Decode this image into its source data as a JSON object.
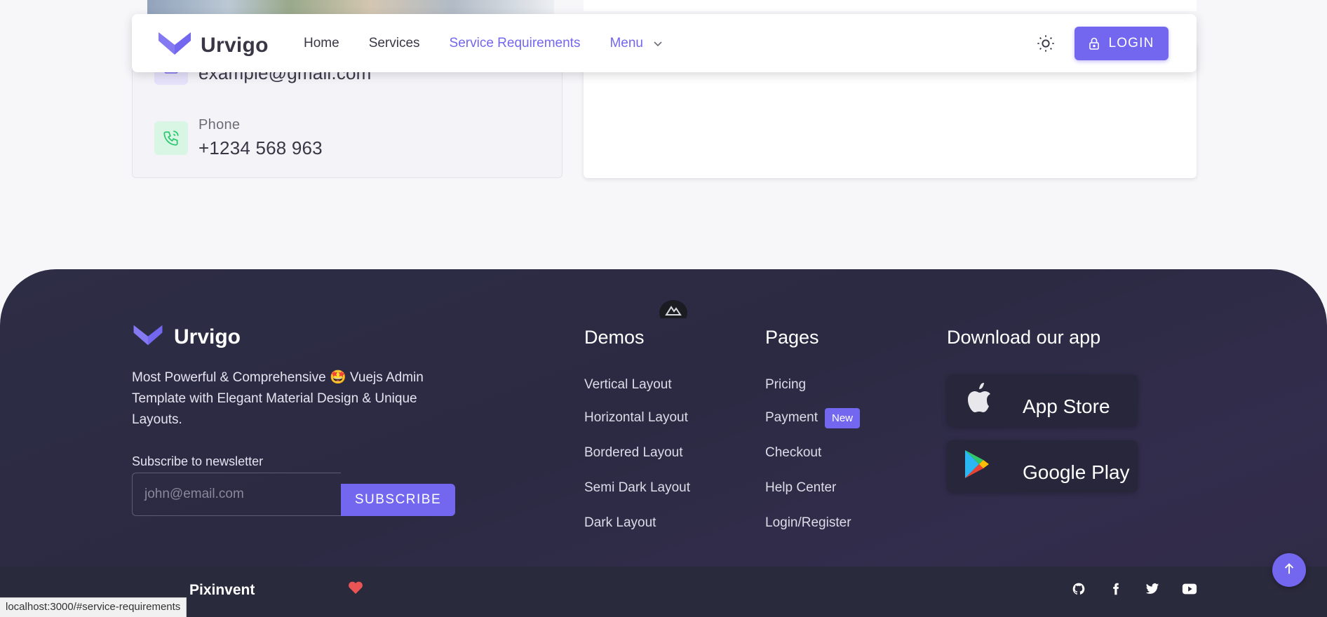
{
  "nav": {
    "brand": "Urvigo",
    "links": [
      "Home",
      "Services",
      "Service Requirements"
    ],
    "menu_label": "Menu",
    "login_label": "LOGIN"
  },
  "contact": {
    "email_value": "example@gmail.com",
    "phone_label": "Phone",
    "phone_value": "+1234 568 963"
  },
  "footer": {
    "brand": "Urvigo",
    "description_before": "Most Powerful & Comprehensive",
    "description_emoji": "🤩",
    "description_after": "Vuejs Admin Template with Elegant Material Design & Unique Layouts.",
    "subscribe_label": "Subscribe to newsletter",
    "subscribe_placeholder": "john@email.com",
    "subscribe_button": "SUBSCRIBE",
    "demos": {
      "title": "Demos",
      "items": [
        "Vertical Layout",
        "Horizontal Layout",
        "Bordered Layout",
        "Semi Dark Layout",
        "Dark Layout"
      ]
    },
    "pages": {
      "title": "Pages",
      "items": [
        "Pricing",
        "Payment",
        "Checkout",
        "Help Center",
        "Login/Register"
      ],
      "badge": "New"
    },
    "download": {
      "title": "Download our app",
      "app_store": "App Store",
      "google_play": "Google Play"
    },
    "bottom_brand": "Pixinvent"
  },
  "status_bar_url": "localhost:3000/#service-requirements",
  "colors": {
    "primary": "#7367f0",
    "footer_bg": "#2d2d45",
    "footer_bottom_bg": "#2a2a3d"
  }
}
